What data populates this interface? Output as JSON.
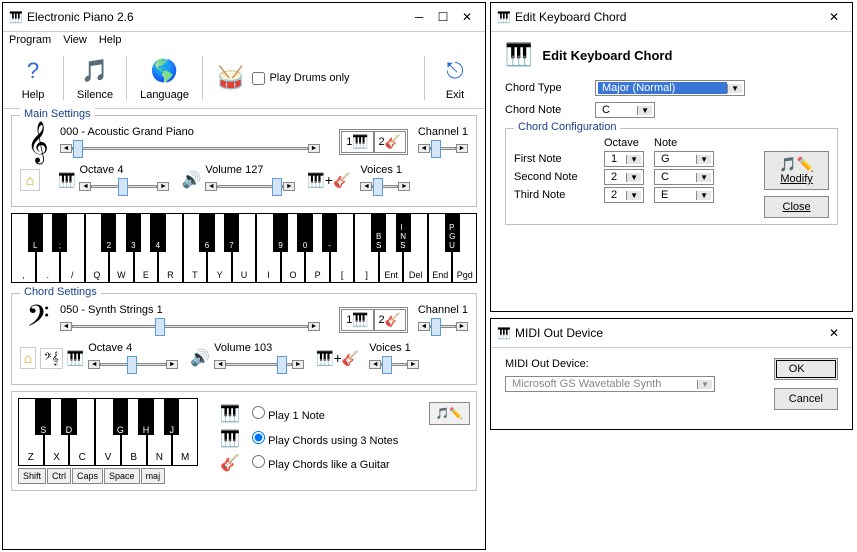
{
  "mainWindow": {
    "title": "Electronic Piano 2.6",
    "menu": {
      "program": "Program",
      "view": "View",
      "help": "Help"
    },
    "toolbar": {
      "help": "Help",
      "silence": "Silence",
      "language": "Language",
      "playDrumsOnly": "Play Drums only",
      "exit": "Exit"
    },
    "mainSettings": {
      "title": "Main Settings",
      "instrument": "000 - Acoustic Grand Piano",
      "octaveLabel": "Octave 4",
      "volumeLabel": "Volume 127",
      "channelLabel": "Channel 1",
      "voicesLabel": "Voices 1",
      "tab1": "1",
      "tab2": "2"
    },
    "mainKeyboard": {
      "whiteKeys": [
        ",",
        ".",
        "/",
        "Q",
        "W",
        "E",
        "R",
        "T",
        "Y",
        "U",
        "I",
        "O",
        "P",
        "[",
        "]",
        "Ent",
        "Del",
        "End",
        "Pgd"
      ],
      "blackKeys": [
        {
          "pos": 0,
          "label": "L"
        },
        {
          "pos": 1,
          "label": ";"
        },
        {
          "pos": 3,
          "label": "2"
        },
        {
          "pos": 4,
          "label": "3"
        },
        {
          "pos": 5,
          "label": "4"
        },
        {
          "pos": 7,
          "label": "6"
        },
        {
          "pos": 8,
          "label": "7"
        },
        {
          "pos": 10,
          "label": "9"
        },
        {
          "pos": 11,
          "label": "0"
        },
        {
          "pos": 12,
          "label": "-"
        },
        {
          "pos": 14,
          "label": "BS"
        },
        {
          "pos": 15,
          "label": "INS"
        },
        {
          "pos": 17,
          "label": "PGU"
        }
      ]
    },
    "chordSettings": {
      "title": "Chord Settings",
      "instrument": "050 - Synth Strings 1",
      "octaveLabel": "Octave 4",
      "volumeLabel": "Volume 103",
      "channelLabel": "Channel 1",
      "voicesLabel": "Voices 1",
      "tab1": "1",
      "tab2": "2"
    },
    "chordKeyboard": {
      "whiteKeys": [
        "Z",
        "X",
        "C",
        "V",
        "B",
        "N",
        "M"
      ],
      "blackKeys": [
        {
          "pos": 0,
          "label": "S"
        },
        {
          "pos": 1,
          "label": "D"
        },
        {
          "pos": 3,
          "label": "G"
        },
        {
          "pos": 4,
          "label": "H"
        },
        {
          "pos": 5,
          "label": "J"
        }
      ],
      "mods": [
        "Shift",
        "Ctrl",
        "Caps",
        "Space",
        "maj"
      ]
    },
    "chordPlayMode": {
      "play1": "Play 1 Note",
      "play3": "Play Chords using 3 Notes",
      "guitar": "Play Chords like a Guitar",
      "selected": "play3"
    }
  },
  "editChord": {
    "title": "Edit Keyboard Chord",
    "heading": "Edit Keyboard Chord",
    "chordTypeLabel": "Chord Type",
    "chordType": "Major (Normal)",
    "chordNoteLabel": "Chord Note",
    "chordNote": "C",
    "configTitle": "Chord Configuration",
    "colOctave": "Octave",
    "colNote": "Note",
    "rows": [
      {
        "label": "First Note",
        "octave": "1",
        "note": "G"
      },
      {
        "label": "Second Note",
        "octave": "2",
        "note": "C"
      },
      {
        "label": "Third Note",
        "octave": "2",
        "note": "E"
      }
    ],
    "modify": "Modify",
    "close": "Close"
  },
  "midiOut": {
    "title": "MIDI Out Device",
    "label": "MIDI Out Device:",
    "device": "Microsoft GS Wavetable Synth",
    "ok": "OK",
    "cancel": "Cancel"
  }
}
